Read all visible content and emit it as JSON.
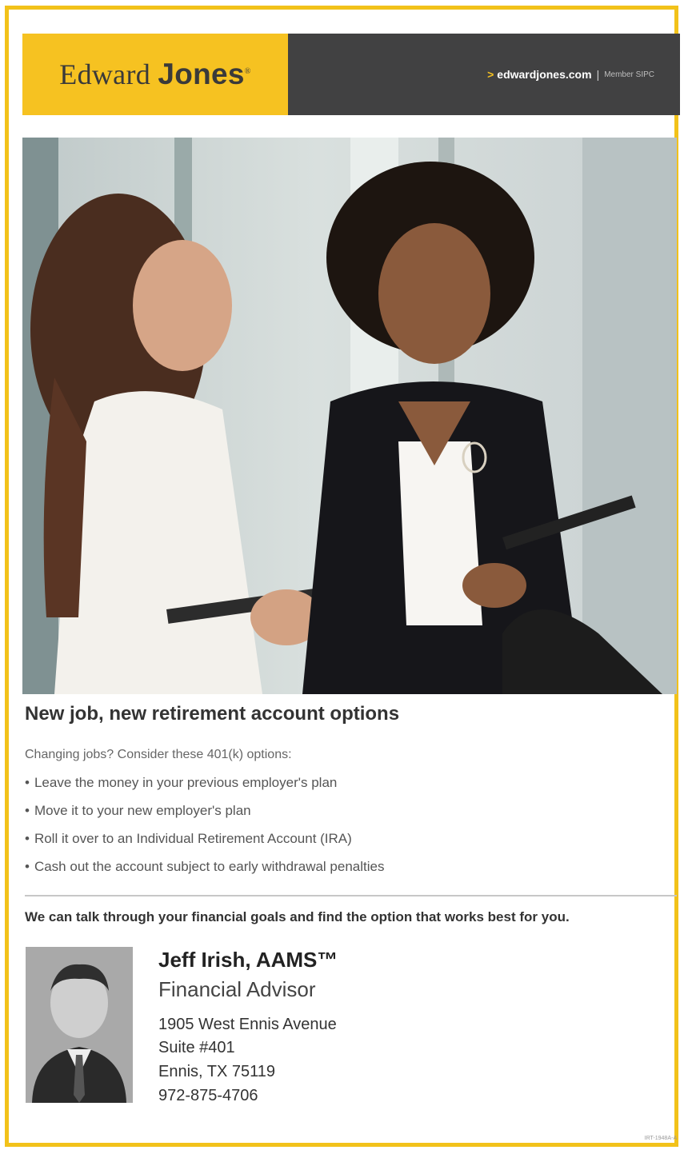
{
  "brand": {
    "logo_first": "Edward",
    "logo_second": "Jones",
    "logo_mark": "®",
    "website": "edwardjones.com",
    "member": "Member SIPC",
    "colors": {
      "yellow": "#f6c221",
      "dark": "#414142",
      "frame": "#f2c21a"
    }
  },
  "ad": {
    "headline": "New job, new retirement account options",
    "intro": "Changing jobs? Consider these 401(k) options:",
    "options": [
      "Leave the money in your previous employer's plan",
      "Move it to your new employer's plan",
      "Roll it over to an Individual Retirement Account (IRA)",
      "Cash out the account subject to early withdrawal penalties"
    ],
    "tagline": "We can talk through your financial goals and find the option that works best for you."
  },
  "advisor": {
    "name": "Jeff Irish, AAMS™",
    "title": "Financial Advisor",
    "address_line1": "1905 West Ennis Avenue",
    "address_line2": "Suite #401",
    "city_state_zip": "Ennis, TX 75119",
    "phone": "972-875-4706"
  },
  "footer": {
    "code": "IRT-1948A-A"
  }
}
